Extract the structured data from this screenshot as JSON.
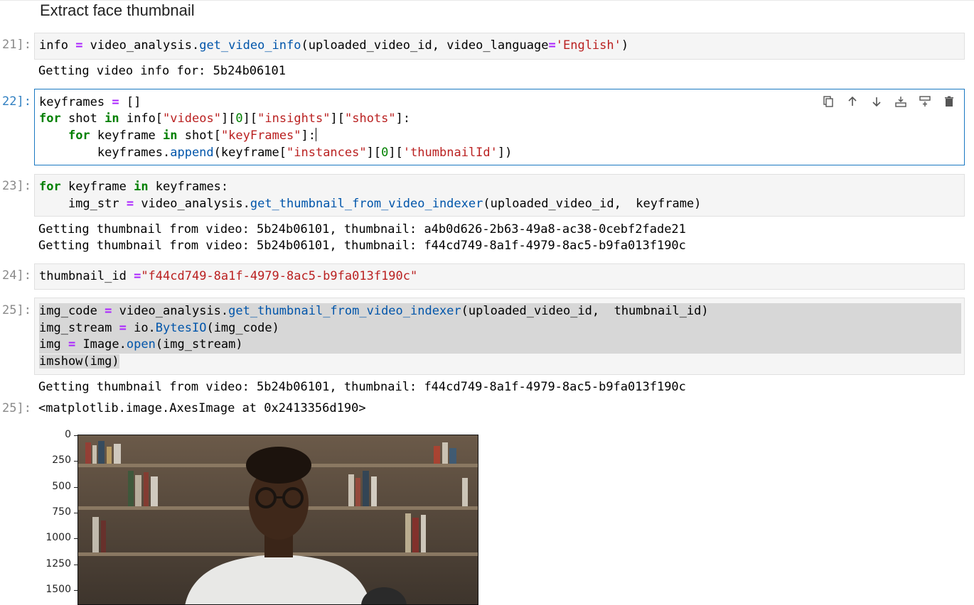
{
  "section": {
    "title": "Extract face thumbnail"
  },
  "cells": {
    "c21": {
      "prompt": "21]:",
      "output": "Getting video info for: 5b24b06101"
    },
    "c22": {
      "prompt": "22]:"
    },
    "c23": {
      "prompt": "23]:",
      "output1": "Getting thumbnail from video: 5b24b06101, thumbnail: a4b0d626-2b63-49a8-ac38-0cebf2fade21",
      "output2": "Getting thumbnail from video: 5b24b06101, thumbnail: f44cd749-8a1f-4979-8ac5-b9fa013f190c"
    },
    "c24": {
      "prompt": "24]:"
    },
    "c25": {
      "prompt": "25]:",
      "output": "Getting thumbnail from video: 5b24b06101, thumbnail: f44cd749-8a1f-4979-8ac5-b9fa013f190c",
      "result_prompt": "25]:",
      "result": "<matplotlib.image.AxesImage at 0x2413356d190>"
    }
  },
  "code": {
    "c21_l1": [
      "info ",
      "=",
      " video_analysis.",
      "get_video_info",
      "(uploaded_video_id, video_language",
      "=",
      "'English'",
      ")"
    ],
    "c22_l1": [
      "keyframes ",
      "=",
      " []"
    ],
    "c22_l2": [
      "for",
      " shot ",
      "in",
      " info[",
      "\"videos\"",
      "][",
      "0",
      "][",
      "\"insights\"",
      "][",
      "\"shots\"",
      "]:"
    ],
    "c22_l3": [
      "    ",
      "for",
      " keyframe ",
      "in",
      " shot[",
      "\"keyFrames\"",
      "]:"
    ],
    "c22_l4": [
      "        keyframes.",
      "append",
      "(keyframe[",
      "\"instances\"",
      "][",
      "0",
      "][",
      "'thumbnailId'",
      "])"
    ],
    "c23_l1": [
      "for",
      " keyframe ",
      "in",
      " keyframes:"
    ],
    "c23_l2": [
      "    img_str ",
      "=",
      " video_analysis.",
      "get_thumbnail_from_video_indexer",
      "(uploaded_video_id,  keyframe)"
    ],
    "c24_l1": [
      "thumbnail_id ",
      "=",
      "\"f44cd749-8a1f-4979-8ac5-b9fa013f190c\""
    ],
    "c25_l1": [
      "img_code ",
      "=",
      " video_analysis.",
      "get_thumbnail_from_video_indexer",
      "(uploaded_video_id,  thumbnail_id)"
    ],
    "c25_l2": [
      "img_stream ",
      "=",
      " io.",
      "BytesIO",
      "(img_code)"
    ],
    "c25_l3": [
      "img ",
      "=",
      " Image.",
      "open",
      "(img_stream)"
    ],
    "c25_l4": [
      "imshow(img)"
    ]
  },
  "toolbar": {
    "icons": [
      "duplicate-icon",
      "move-up-icon",
      "move-down-icon",
      "insert-above-icon",
      "insert-below-icon",
      "delete-icon"
    ]
  },
  "plot": {
    "y_ticks": [
      "0",
      "250",
      "500",
      "750",
      "1000",
      "1250",
      "1500"
    ]
  }
}
